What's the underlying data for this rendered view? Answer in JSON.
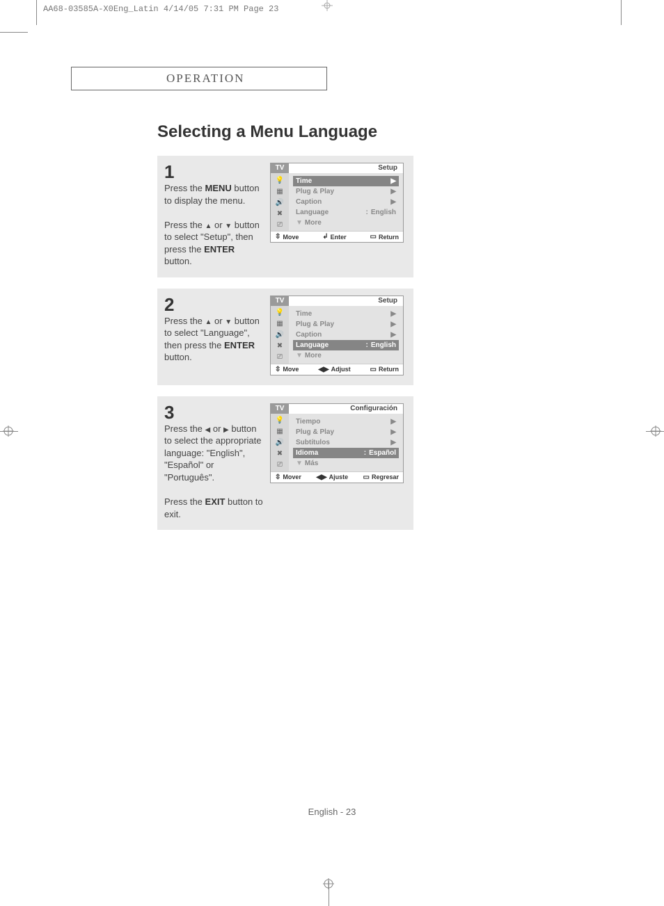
{
  "headerLine": "AA68-03585A-X0Eng_Latin  4/14/05  7:31 PM  Page 23",
  "sectionTitle": "OPERATION",
  "pageTitle": "Selecting a Menu Language",
  "steps": [
    {
      "num": "1",
      "textHtml": "Press the <b>MENU</b> button to display the menu.<br><br>Press the <span class='tri'>▲</span> or <span class='tri'>▼</span> button to select \"Setup\", then press the <b>ENTER</b> button.",
      "osd": {
        "tv": "TV",
        "title": "Setup",
        "rows": [
          {
            "label": "Time",
            "value": "",
            "arrow": "▶",
            "hl": true
          },
          {
            "label": "Plug & Play",
            "value": "",
            "arrow": "▶",
            "hl": false
          },
          {
            "label": "Caption",
            "value": "",
            "arrow": "▶",
            "hl": false
          },
          {
            "label": "Language",
            "sep": ":",
            "value": "English",
            "arrow": "",
            "hl": false
          },
          {
            "label": "More",
            "value": "",
            "arrow": "",
            "hl": false,
            "more": true
          }
        ],
        "footer": [
          {
            "glyph": "⇳",
            "label": "Move"
          },
          {
            "glyph": "↲",
            "label": "Enter"
          },
          {
            "glyph": "▭",
            "label": "Return"
          }
        ]
      }
    },
    {
      "num": "2",
      "textHtml": "Press the <span class='tri'>▲</span> or <span class='tri'>▼</span> button to select \"Language\", then press the <b>ENTER</b> button.",
      "osd": {
        "tv": "TV",
        "title": "Setup",
        "rows": [
          {
            "label": "Time",
            "value": "",
            "arrow": "▶",
            "hl": false
          },
          {
            "label": "Plug & Play",
            "value": "",
            "arrow": "▶",
            "hl": false
          },
          {
            "label": "Caption",
            "value": "",
            "arrow": "▶",
            "hl": false
          },
          {
            "label": "Language",
            "sep": ":",
            "value": "English",
            "arrow": "",
            "hl": true
          },
          {
            "label": "More",
            "value": "",
            "arrow": "",
            "hl": false,
            "more": true
          }
        ],
        "footer": [
          {
            "glyph": "⇳",
            "label": "Move"
          },
          {
            "glyph": "◀▶",
            "label": "Adjust"
          },
          {
            "glyph": "▭",
            "label": "Return"
          }
        ]
      }
    },
    {
      "num": "3",
      "textHtml": "Press the <span class='tri'>◀</span> or <span class='tri'>▶</span> button to select the appropriate language: \"English\", \"Español\" or \"Português\".<br><br>Press the <b>EXIT</b> button to exit.",
      "osd": {
        "tv": "TV",
        "title": "Configuración",
        "rows": [
          {
            "label": "Tiempo",
            "value": "",
            "arrow": "▶",
            "hl": false
          },
          {
            "label": "Plug & Play",
            "value": "",
            "arrow": "▶",
            "hl": false
          },
          {
            "label": "Subtítulos",
            "value": "",
            "arrow": "▶",
            "hl": false
          },
          {
            "label": "Idioma",
            "sep": ":",
            "value": "Español",
            "arrow": "",
            "hl": true
          },
          {
            "label": "Más",
            "value": "",
            "arrow": "",
            "hl": false,
            "more": true
          }
        ],
        "footer": [
          {
            "glyph": "⇳",
            "label": "Mover"
          },
          {
            "glyph": "◀▶",
            "label": "Ajuste"
          },
          {
            "glyph": "▭",
            "label": "Regresar"
          }
        ]
      }
    }
  ],
  "osdIcons": [
    "bulb",
    "channel",
    "sound",
    "plug",
    "sliders"
  ],
  "pageFooter": "English - 23"
}
